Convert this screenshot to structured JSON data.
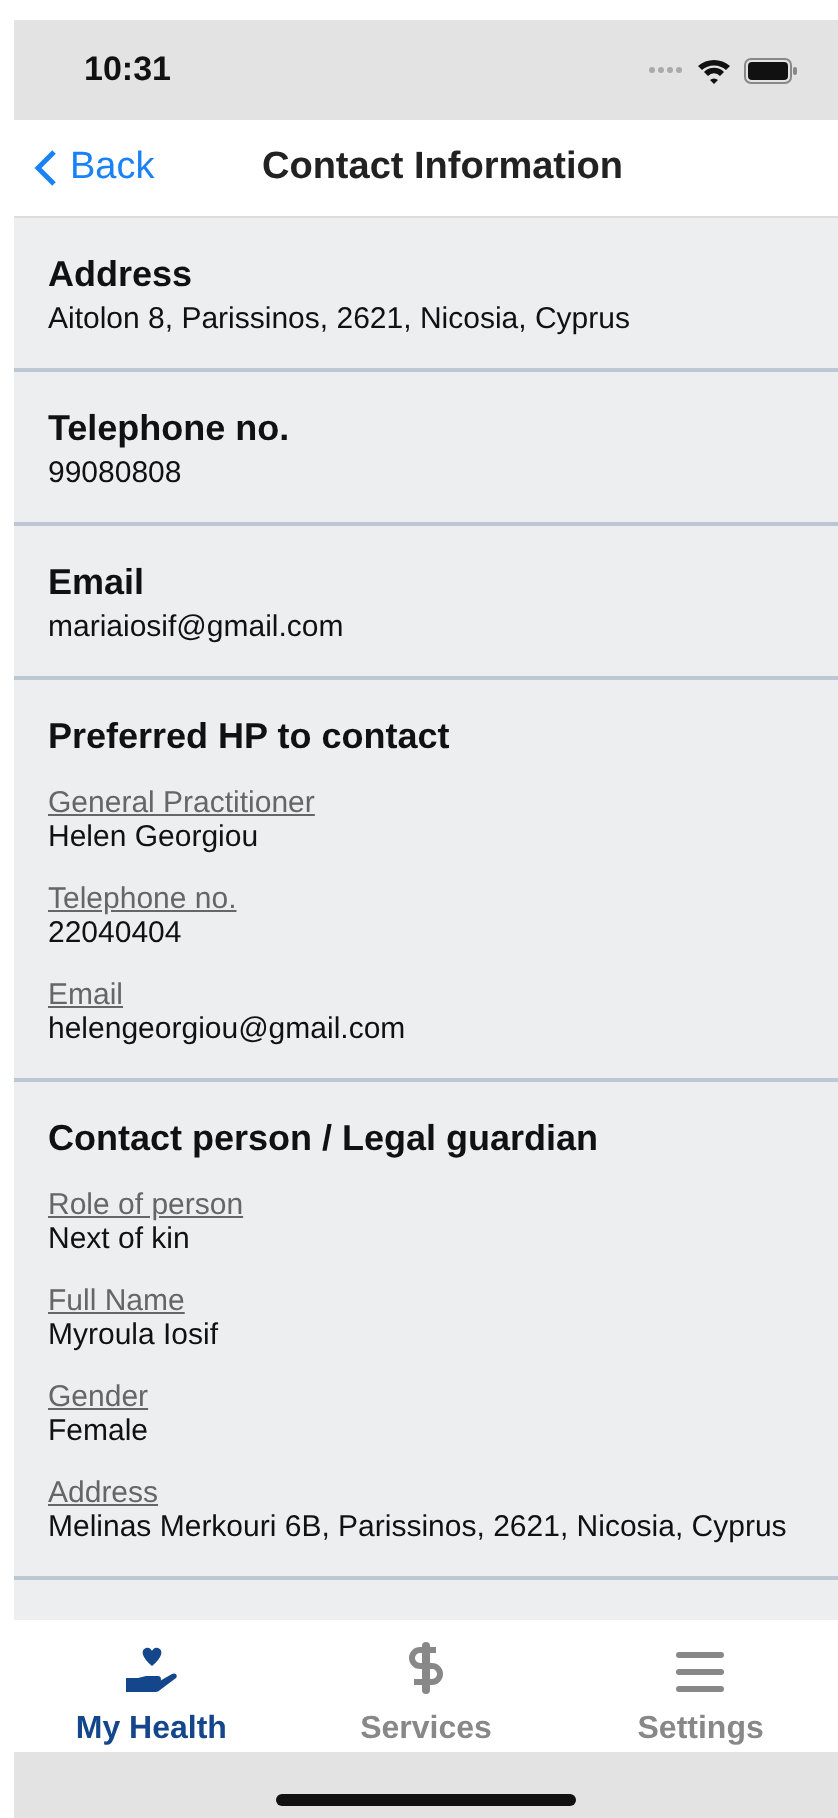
{
  "status_bar": {
    "time": "10:31"
  },
  "nav": {
    "back": "Back",
    "title": "Contact Information"
  },
  "sections": [
    {
      "title": "Address",
      "value": "Aitolon 8, Parissinos, 2621, Nicosia, Cyprus"
    },
    {
      "title": "Telephone no.",
      "value": "99080808"
    },
    {
      "title": "Email",
      "value": "mariaiosif@gmail.com"
    },
    {
      "title": "Preferred HP to contact",
      "fields": [
        {
          "label": "General Practitioner",
          "value": "Helen Georgiou"
        },
        {
          "label": "Telephone no.",
          "value": "22040404"
        },
        {
          "label": "Email",
          "value": "helengeorgiou@gmail.com"
        }
      ]
    },
    {
      "title": "Contact person / Legal guardian",
      "fields": [
        {
          "label": "Role of person",
          "value": "Next of kin"
        },
        {
          "label": "Full Name",
          "value": "Myroula Iosif"
        },
        {
          "label": "Gender",
          "value": "Female"
        },
        {
          "label": "Address",
          "value": "Melinas Merkouri 6B, Parissinos, 2621, Nicosia, Cyprus"
        }
      ]
    }
  ],
  "tabs": [
    {
      "label": "My Health",
      "kind": "health",
      "selected": true
    },
    {
      "label": "Services",
      "kind": "services",
      "selected": false
    },
    {
      "label": "Settings",
      "kind": "settings",
      "selected": false
    }
  ]
}
